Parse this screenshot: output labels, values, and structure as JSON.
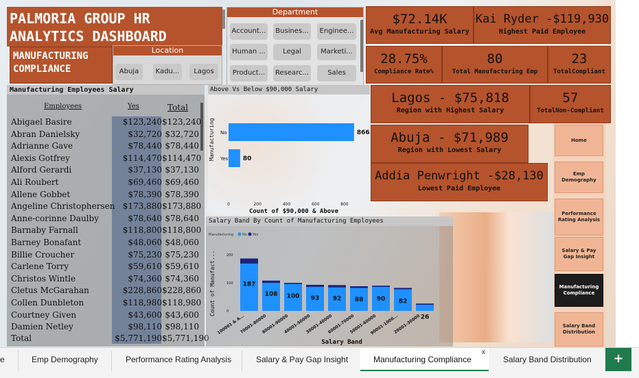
{
  "title_line1": "PALMORIA GROUP HR",
  "title_line2": "ANALYTICS DASHBOARD",
  "subtitle_line1": "MANUFACTURING",
  "subtitle_line2": "COMPLIANCE",
  "location_slicer": {
    "title": "Location",
    "items": [
      "Abuja",
      "Kadu...",
      "Lagos"
    ]
  },
  "department_slicer": {
    "title": "Department",
    "items": [
      "Account...",
      "Busines...",
      "Enginee...",
      "Human ...",
      "Legal",
      "Marketi...",
      "Product...",
      "Researc...",
      "Sales"
    ]
  },
  "kpis": {
    "avg_salary": {
      "value": "$72.14K",
      "label": "Avg Manufacturing Salary"
    },
    "highest_paid": {
      "value": "Kai Ryder -$119,930",
      "label": "Highest Paid Employee"
    },
    "compliance_rate": {
      "value": "28.75%",
      "label": "Compliance Rate%"
    },
    "total_emp": {
      "value": "80",
      "label": "Total Manufacturing Emp"
    },
    "total_compliant": {
      "value": "23",
      "label": "TotalCompliant"
    },
    "highest_region": {
      "value": "Lagos - $75,818",
      "label": "Region with Highest Salary"
    },
    "non_compliant": {
      "value": "57",
      "label": "TotalNon-Compliant"
    },
    "lowest_region": {
      "value": "Abuja - $71,989",
      "label": "Region with Lowest Salary"
    },
    "lowest_paid": {
      "value": "Addia Penwright -$28,130",
      "label": "Lowest Paid Employee"
    }
  },
  "salary_table": {
    "title": "Manufacturing Employees Salary",
    "headers": [
      "Employees",
      "Yes",
      "Total"
    ],
    "rows": [
      [
        "Abigael Basire",
        "$123,240",
        "$123,240"
      ],
      [
        "Abran Danielsky",
        "$32,720",
        "$32,720"
      ],
      [
        "Adrianne Gave",
        "$78,440",
        "$78,440"
      ],
      [
        "Alexis Gotfrey",
        "$114,470",
        "$114,470"
      ],
      [
        "Alford Gerardi",
        "$37,130",
        "$37,130"
      ],
      [
        "Ali Roubert",
        "$69,460",
        "$69,460"
      ],
      [
        "Allene Gobbet",
        "$78,390",
        "$78,390"
      ],
      [
        "Angeline Christophersen",
        "$173,880",
        "$173,880"
      ],
      [
        "Anne-corinne Daulby",
        "$78,640",
        "$78,640"
      ],
      [
        "Barnaby Farnall",
        "$118,800",
        "$118,800"
      ],
      [
        "Barney Bonafant",
        "$48,060",
        "$48,060"
      ],
      [
        "Billie Croucher",
        "$75,230",
        "$75,230"
      ],
      [
        "Carlene Torry",
        "$59,610",
        "$59,610"
      ],
      [
        "Christos Wintle",
        "$74,360",
        "$74,360"
      ],
      [
        "Cletus McGarahan",
        "$228,860",
        "$228,860"
      ],
      [
        "Collen Dunbleton",
        "$118,980",
        "$118,980"
      ],
      [
        "Courtney Given",
        "$43,600",
        "$43,600"
      ],
      [
        "Damien Netley",
        "$98,110",
        "$98,110"
      ]
    ],
    "total": [
      "Total",
      "$5,771,190",
      "$5,771,190"
    ]
  },
  "chart_data": [
    {
      "type": "bar",
      "title": "Above Vs Below $90,000 Salary",
      "orientation": "horizontal",
      "categories": [
        "No",
        "Yes"
      ],
      "values": [
        866,
        80
      ],
      "xlabel": "Count of $90,000 & Above",
      "ylabel": "Manufacturing",
      "xticks": [
        "0",
        "200",
        "400",
        "600",
        "800"
      ],
      "xlim": [
        0,
        900
      ],
      "color": "#1e90ff"
    },
    {
      "type": "bar",
      "title": "Salary Band By Count of Manufacturing Employees",
      "legend_title": "Manufacturing",
      "legend": [
        "No",
        "Yes"
      ],
      "categories": [
        "100001 & A...",
        "70001-80000",
        "80001-90000",
        "40001-50000",
        "30001-40000",
        "60001-70000",
        "50001-60000",
        "90001-1000...",
        "20001-30000"
      ],
      "values": [
        187,
        108,
        100,
        93,
        92,
        88,
        90,
        82,
        26
      ],
      "yes_overlay": [
        18,
        8,
        4,
        7,
        8,
        6,
        4,
        5,
        4
      ],
      "xlabel": "Salary Band",
      "ylabel": "Count of Manufact...",
      "yticks": [
        "0",
        "100",
        "200"
      ],
      "ylim": [
        0,
        220
      ],
      "colors": {
        "No": "#1e90ff",
        "Yes": "#1a237e"
      }
    }
  ],
  "nav_buttons": [
    "Home",
    "Emp Demography",
    "Performance Rating Analysis",
    "Salary & Pay Gap Insight",
    "Manufacturing Compliance",
    "Salary Band Distribution"
  ],
  "tabs": [
    "e",
    "Emp Demography",
    "Performance Rating Analysis",
    "Salary & Pay Gap Insight",
    "Manufacturing Compliance",
    "Salary Band Distribution"
  ],
  "active_tab": "Manufacturing Compliance",
  "tab_close": "x",
  "add_tab": "+"
}
